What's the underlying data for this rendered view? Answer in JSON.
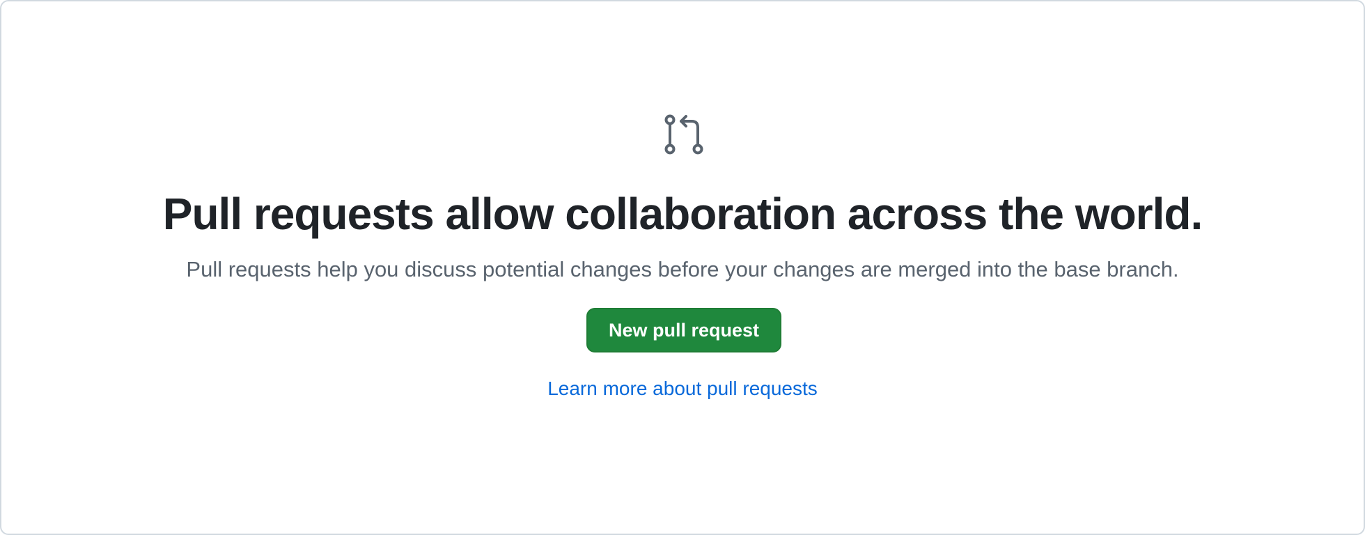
{
  "empty_state": {
    "icon": "git-pull-request-icon",
    "icon_color": "#59636e",
    "heading": "Pull requests allow collaboration across the world.",
    "description": "Pull requests help you discuss potential changes before your changes are merged into the base branch.",
    "primary_button_label": "New pull request",
    "primary_button_color": "#1f883d",
    "link_label": "Learn more about pull requests",
    "link_color": "#0969da"
  }
}
